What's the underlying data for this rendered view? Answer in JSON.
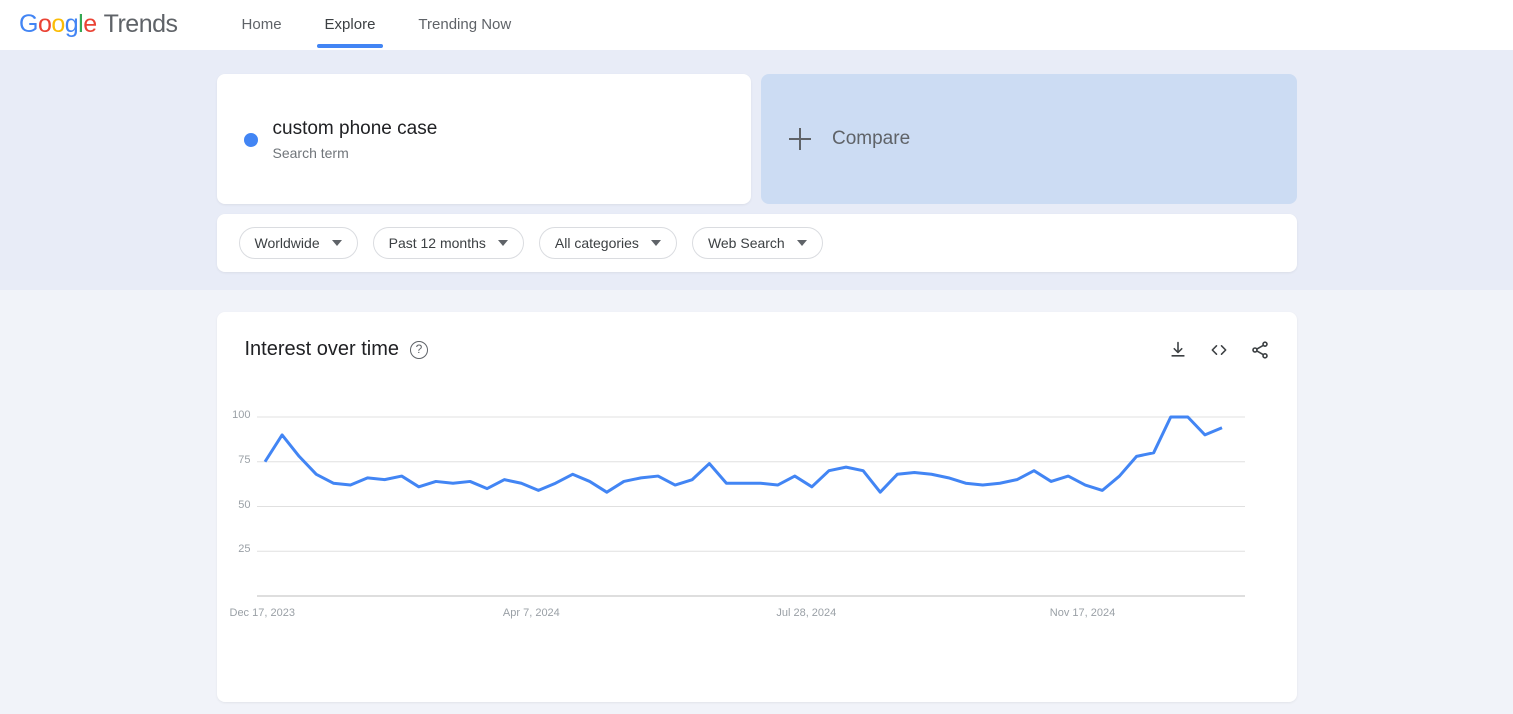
{
  "nav": {
    "brand": {
      "g1": "G",
      "o1": "o",
      "o2": "o",
      "g2": "g",
      "l1": "l",
      "e1": "e",
      "word": "Trends"
    },
    "links": [
      {
        "label": "Home",
        "active": false
      },
      {
        "label": "Explore",
        "active": true
      },
      {
        "label": "Trending Now",
        "active": false
      }
    ]
  },
  "search": {
    "term": "custom phone case",
    "type": "Search term",
    "dot_color": "#4285F4"
  },
  "compare": {
    "label": "Compare",
    "icon": "plus-icon"
  },
  "filters": [
    {
      "name": "location",
      "label": "Worldwide"
    },
    {
      "name": "time-range",
      "label": "Past 12 months"
    },
    {
      "name": "category",
      "label": "All categories"
    },
    {
      "name": "search-type",
      "label": "Web Search"
    }
  ],
  "chart_panel": {
    "title": "Interest over time",
    "help_glyph": "?",
    "actions": [
      {
        "name": "download-icon",
        "label": "Download"
      },
      {
        "name": "embed-code-icon",
        "label": "Embed"
      },
      {
        "name": "share-icon",
        "label": "Share"
      }
    ]
  },
  "chart_data": {
    "type": "line",
    "title": "Interest over time",
    "xlabel": "",
    "ylabel": "",
    "ylim": [
      0,
      100
    ],
    "yticks": [
      100,
      75,
      50,
      25
    ],
    "grid": true,
    "legend": false,
    "line_color": "#4285F4",
    "xticks": [
      "Dec 17, 2023",
      "Apr 7, 2024",
      "Jul 28, 2024",
      "Nov 17, 2024"
    ],
    "xtick_positions": [
      0,
      16,
      32,
      48
    ],
    "series": [
      {
        "name": "custom phone case",
        "values": [
          75,
          90,
          78,
          68,
          63,
          62,
          66,
          65,
          67,
          61,
          64,
          63,
          64,
          60,
          65,
          63,
          59,
          63,
          68,
          64,
          58,
          64,
          66,
          67,
          62,
          65,
          74,
          63,
          63,
          63,
          62,
          67,
          61,
          70,
          72,
          70,
          58,
          68,
          69,
          68,
          66,
          63,
          62,
          63,
          65,
          70,
          64,
          67,
          62,
          59,
          67,
          78,
          80,
          100,
          100,
          90,
          94
        ]
      }
    ]
  }
}
